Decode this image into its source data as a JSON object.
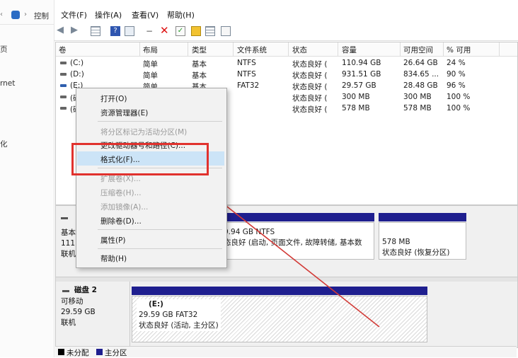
{
  "left_pane": {
    "breadcrumb": "控制",
    "items": [
      "页",
      "rnet",
      "化"
    ]
  },
  "menu": [
    "文件(F)",
    "操作(A)",
    "查看(V)",
    "帮助(H)"
  ],
  "toolbar_icons": [
    "back-icon",
    "forward-icon",
    "grid-icon",
    "help-icon",
    "properties-icon",
    "connect-icon",
    "delete-icon",
    "check-icon",
    "search-icon",
    "list-icon"
  ],
  "columns": [
    "卷",
    "布局",
    "类型",
    "文件系统",
    "状态",
    "容量",
    "可用空间",
    "% 可用"
  ],
  "volumes": [
    {
      "name": "(C:)",
      "layout": "简单",
      "type": "基本",
      "fs": "NTFS",
      "status": "状态良好 (",
      "capacity": "110.94 GB",
      "free": "26.64 GB",
      "pct": "24 %"
    },
    {
      "name": "(D:)",
      "layout": "简单",
      "type": "基本",
      "fs": "NTFS",
      "status": "状态良好 (",
      "capacity": "931.51 GB",
      "free": "834.65 ...",
      "pct": "90 %"
    },
    {
      "name": "(E:)",
      "layout": "简单",
      "type": "基本",
      "fs": "FAT32",
      "status": "状态良好 (",
      "capacity": "29.57 GB",
      "free": "28.48 GB",
      "pct": "96 %"
    },
    {
      "name": "(磁",
      "layout": "",
      "type": "",
      "fs": "",
      "status": "状态良好 (",
      "capacity": "300 MB",
      "free": "300 MB",
      "pct": "100 %"
    },
    {
      "name": "(磁",
      "layout": "",
      "type": "",
      "fs": "",
      "status": "状态良好 (",
      "capacity": "578 MB",
      "free": "578 MB",
      "pct": "100 %"
    }
  ],
  "context_menu": [
    {
      "label": "打开(O)",
      "enabled": true
    },
    {
      "label": "资源管理器(E)",
      "enabled": true
    },
    {
      "label": "将分区标记为活动分区(M)",
      "enabled": false
    },
    {
      "label": "更改驱动器号和路径(C)...",
      "enabled": true
    },
    {
      "label": "格式化(F)...",
      "enabled": true,
      "highlighted": true
    },
    {
      "label": "扩展卷(X)...",
      "enabled": false
    },
    {
      "label": "压缩卷(H)...",
      "enabled": false
    },
    {
      "label": "添加镜像(A)...",
      "enabled": false
    },
    {
      "label": "删除卷(D)...",
      "enabled": true
    },
    {
      "label": "属性(P)",
      "enabled": true
    },
    {
      "label": "帮助(H)",
      "enabled": true
    }
  ],
  "disk1": {
    "labels": [
      "基本",
      "111.",
      "联机"
    ],
    "partition_c": {
      "line1": "0.94 GB NTFS",
      "line2": "态良好 (启动, 页面文件, 故障转储, 基本数"
    },
    "partition_recovery": {
      "line1": "578 MB",
      "line2": "状态良好 (恢复分区)"
    }
  },
  "disk2": {
    "title": "磁盘 2",
    "labels": [
      "可移动",
      "29.59 GB",
      "联机"
    ],
    "partition": {
      "name": "(E:)",
      "line1": "29.59 GB FAT32",
      "line2": "状态良好 (活动, 主分区)"
    }
  },
  "legend": [
    {
      "label": "未分配",
      "color": "#000000"
    },
    {
      "label": "主分区",
      "color": "#1f1f8f"
    }
  ],
  "colors": {
    "highlight": "#cce4f7",
    "annotation": "#e1322e",
    "partition_bar": "#1f1f8f"
  }
}
